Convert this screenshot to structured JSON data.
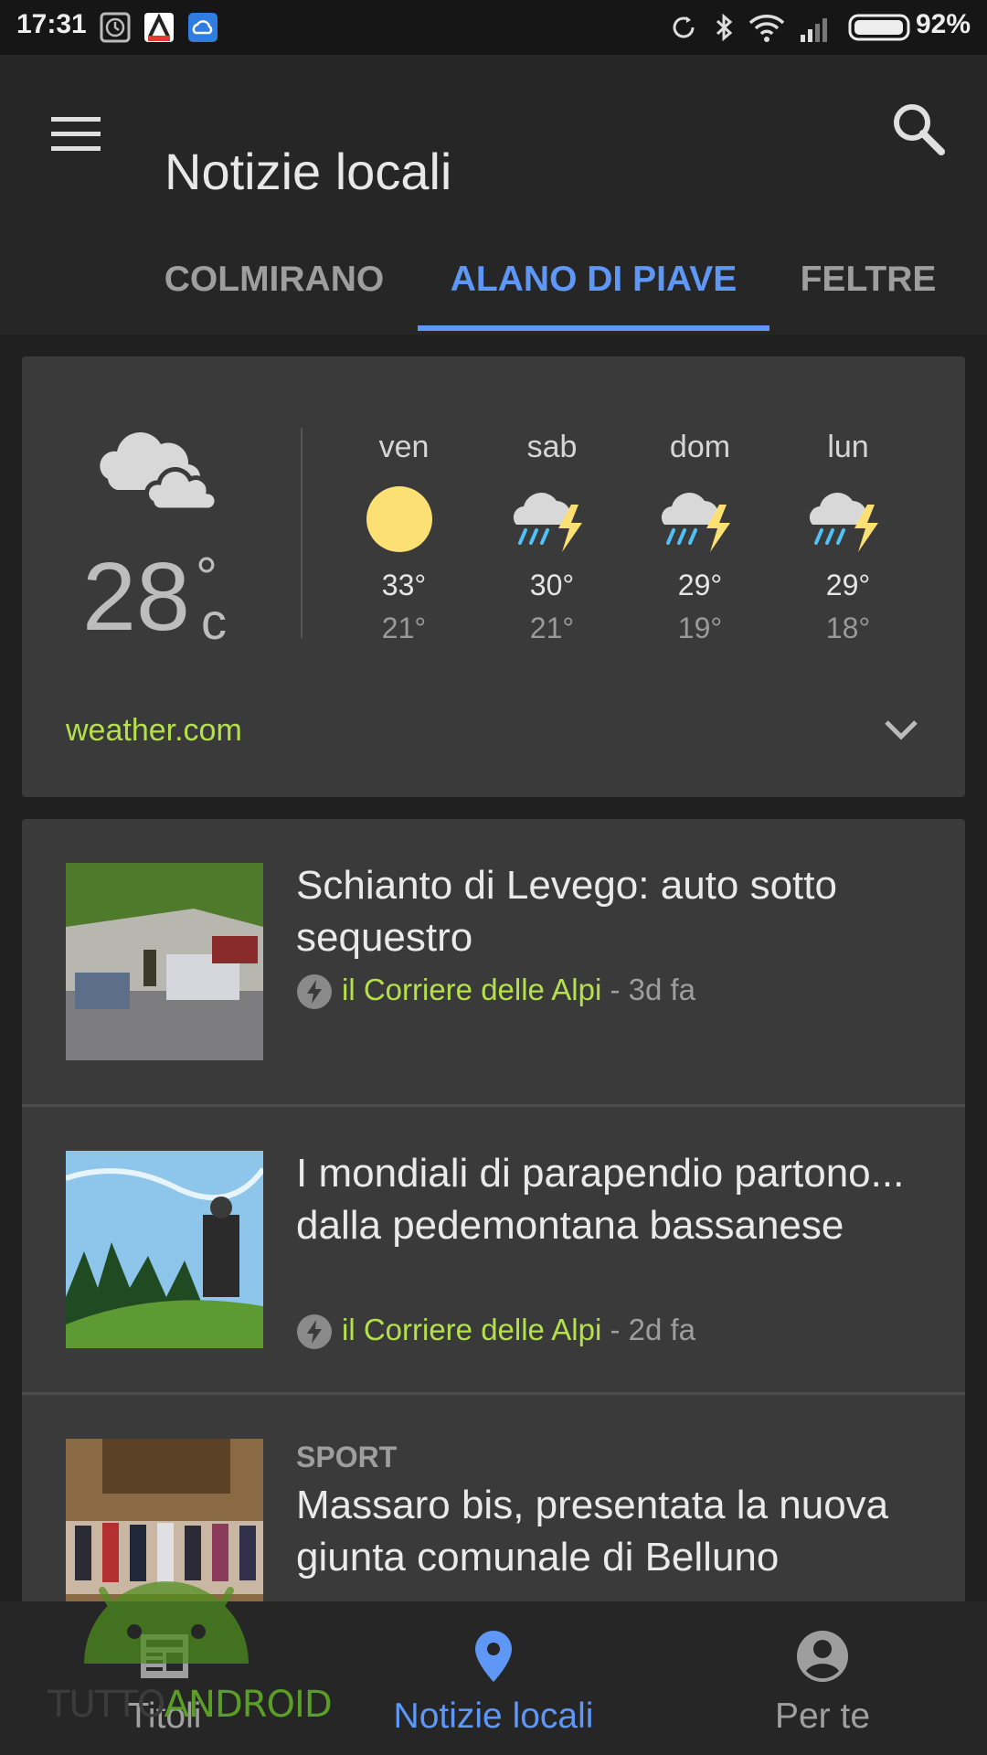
{
  "status_bar": {
    "time": "17:31",
    "battery_percent": "92%",
    "icons": [
      "alarm-icon",
      "app-a-icon",
      "cloud-icon",
      "sync-icon",
      "bluetooth-icon",
      "wifi-icon",
      "signal-icon",
      "battery-icon"
    ]
  },
  "app_bar": {
    "title": "Notizie locali",
    "menu_icon": "menu-icon",
    "search_icon": "search-icon"
  },
  "tabs": [
    {
      "label": "COLMIRANO",
      "active": false
    },
    {
      "label": "ALANO DI PIAVE",
      "active": true
    },
    {
      "label": "FELTRE",
      "active": false
    }
  ],
  "weather": {
    "current": {
      "temp": "28",
      "deg": "°",
      "unit": "c",
      "icon": "cloudy-icon"
    },
    "forecast": [
      {
        "day": "ven",
        "high": "33°",
        "low": "21°",
        "icon": "sun-icon"
      },
      {
        "day": "sab",
        "high": "30°",
        "low": "21°",
        "icon": "thunderstorm-icon"
      },
      {
        "day": "dom",
        "high": "29°",
        "low": "19°",
        "icon": "thunderstorm-icon"
      },
      {
        "day": "lun",
        "high": "29°",
        "low": "18°",
        "icon": "thunderstorm-icon"
      }
    ],
    "source": "weather.com"
  },
  "news": [
    {
      "headline": "Schianto di Levego: auto sotto sequestro",
      "source": "il Corriere delle Alpi",
      "age": "- 3d fa"
    },
    {
      "headline": "I mondiali di parapendio partono... dalla pedemontana bassanese",
      "source": "il Corriere delle Alpi",
      "age": "- 2d fa"
    },
    {
      "kicker": "SPORT",
      "headline": "Massaro bis, presentata la nuova giunta comunale di Belluno"
    }
  ],
  "bottom_nav": [
    {
      "label": "Titoli",
      "icon": "newspaper-icon",
      "active": false
    },
    {
      "label": "Notizie locali",
      "icon": "location-pin-icon",
      "active": true
    },
    {
      "label": "Per te",
      "icon": "account-circle-icon",
      "active": false
    }
  ],
  "watermark": {
    "part1": "TUTTO",
    "part2": "ANDROID"
  },
  "colors": {
    "accent": "#5e97f6",
    "source": "#b4e14a",
    "background": "#202020",
    "card": "#3a3a3a"
  }
}
